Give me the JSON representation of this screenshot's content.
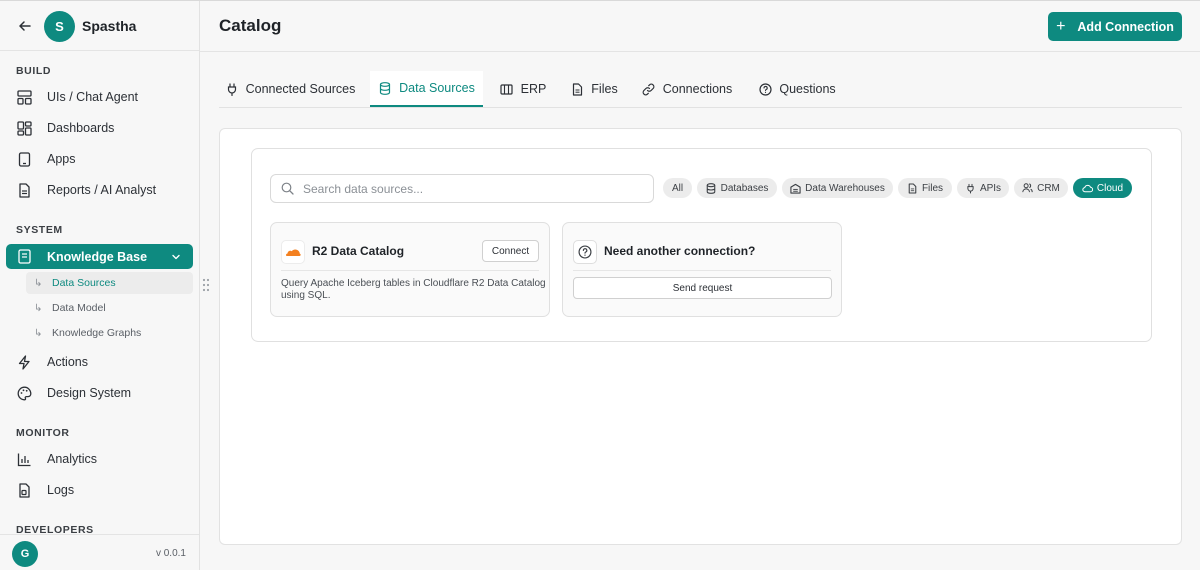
{
  "sidebar": {
    "org_initial": "S",
    "org_name": "Spastha",
    "sections": {
      "build": "BUILD",
      "system": "SYSTEM",
      "monitor": "MONITOR",
      "developers": "DEVELOPERS"
    },
    "build_items": [
      {
        "label": "UIs / Chat Agent",
        "icon": "layout-icon"
      },
      {
        "label": "Dashboards",
        "icon": "dashboard-grid-icon"
      },
      {
        "label": "Apps",
        "icon": "tablet-icon"
      },
      {
        "label": "Reports / AI Analyst",
        "icon": "report-icon"
      }
    ],
    "system_items": [
      {
        "label": "Knowledge Base",
        "icon": "book-icon",
        "active": true
      },
      {
        "label": "Actions",
        "icon": "lightning-icon"
      },
      {
        "label": "Design System",
        "icon": "palette-icon"
      }
    ],
    "knowledge_sub": [
      {
        "label": "Data Sources",
        "active": true
      },
      {
        "label": "Data Model"
      },
      {
        "label": "Knowledge Graphs"
      }
    ],
    "monitor_items": [
      {
        "label": "Analytics",
        "icon": "bar-chart-icon"
      },
      {
        "label": "Logs",
        "icon": "logs-icon"
      }
    ],
    "user_initial": "G",
    "version": "v 0.0.1"
  },
  "header": {
    "title": "Catalog",
    "add_button": "Add Connection"
  },
  "tabs": [
    {
      "label": "Connected Sources",
      "icon": "plug-icon"
    },
    {
      "label": "Data Sources",
      "icon": "database-icon",
      "active": true
    },
    {
      "label": "ERP",
      "icon": "building-icon"
    },
    {
      "label": "Files",
      "icon": "file-icon"
    },
    {
      "label": "Connections",
      "icon": "link-icon"
    },
    {
      "label": "Questions",
      "icon": "question-icon"
    }
  ],
  "search": {
    "placeholder": "Search data sources..."
  },
  "filters": [
    {
      "label": "All"
    },
    {
      "label": "Databases",
      "icon": "database-icon"
    },
    {
      "label": "Data Warehouses",
      "icon": "warehouse-icon"
    },
    {
      "label": "Files",
      "icon": "file-icon"
    },
    {
      "label": "APIs",
      "icon": "plug-icon"
    },
    {
      "label": "CRM",
      "icon": "users-icon"
    },
    {
      "label": "Cloud",
      "icon": "cloud-icon",
      "active": true
    }
  ],
  "cards": {
    "r2": {
      "title": "R2 Data Catalog",
      "connect": "Connect",
      "description": "Query Apache Iceberg tables in Cloudflare R2 Data Catalog using SQL.",
      "logo": "cloudflare-logo-icon"
    },
    "request": {
      "title": "Need another connection?",
      "button": "Send request"
    }
  },
  "colors": {
    "accent": "#0e8a80",
    "cloudflare_orange": "#f38020"
  }
}
